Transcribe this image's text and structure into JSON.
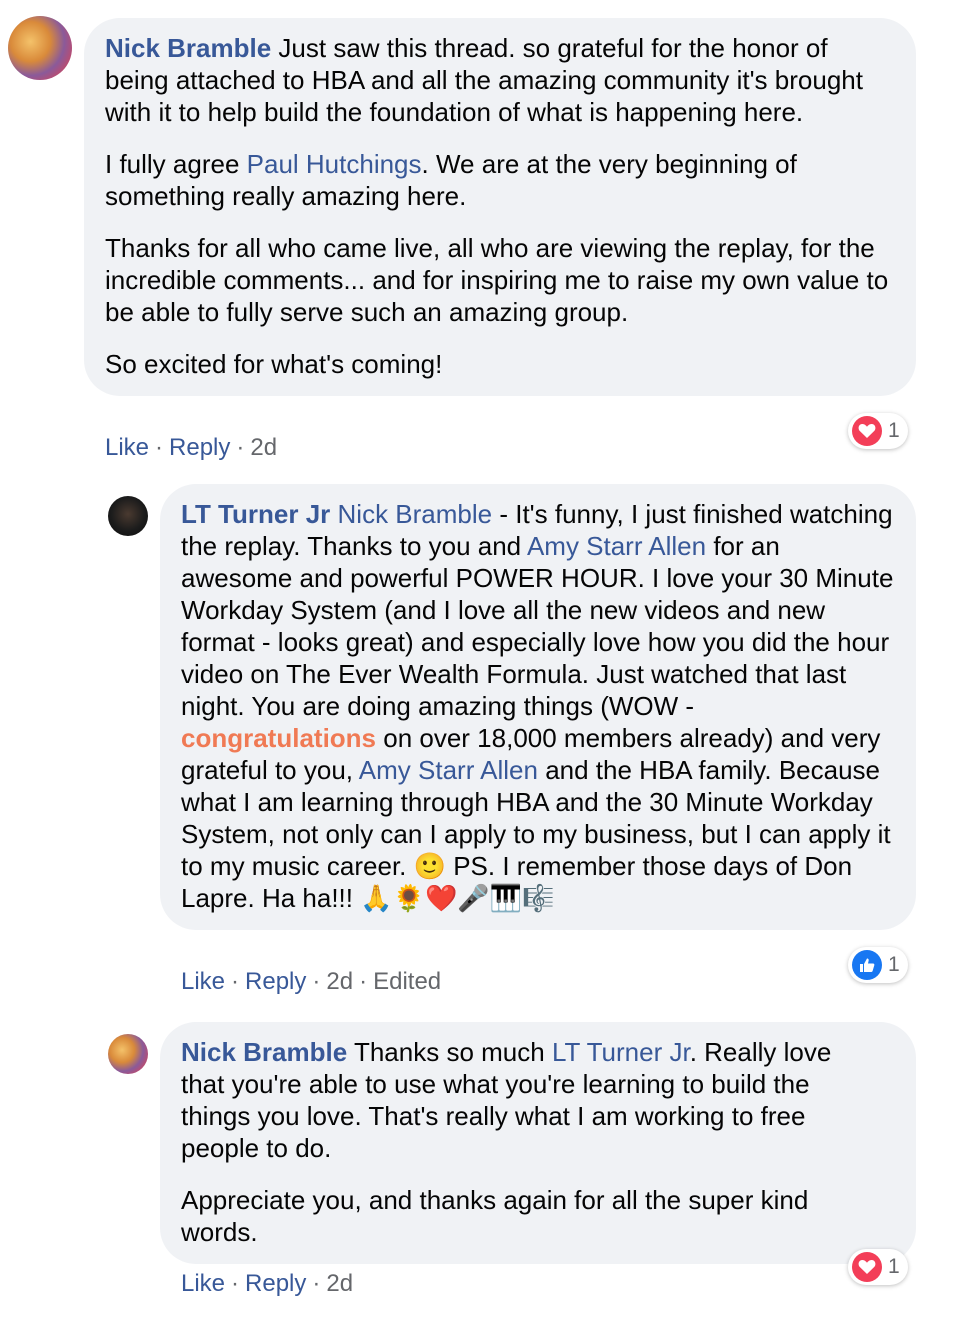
{
  "comments": [
    {
      "author": "Nick Bramble",
      "paragraphs": [
        [
          {
            "t": "text",
            "v": "Just saw this thread. so grateful for the honor of being attached to HBA and all the amazing community it's brought with it to help build the foundation of what is happening here."
          }
        ],
        [
          {
            "t": "text",
            "v": "I fully agree "
          },
          {
            "t": "mention",
            "v": "Paul Hutchings"
          },
          {
            "t": "text",
            "v": ". We are at the very beginning of something really amazing here."
          }
        ],
        [
          {
            "t": "text",
            "v": "Thanks for all who came live, all who are viewing the replay, for the incredible comments... and for inspiring me to raise my own value to be able to fully serve such an amazing group."
          }
        ],
        [
          {
            "t": "text",
            "v": "So excited for what's coming!"
          }
        ]
      ],
      "like": "Like",
      "reply": "Reply",
      "time": "2d",
      "reaction": {
        "type": "love",
        "count": "1"
      }
    },
    {
      "author": "LT Turner Jr",
      "paragraphs": [
        [
          {
            "t": "mention",
            "v": "Nick Bramble"
          },
          {
            "t": "text",
            "v": " - It's funny, I just finished watching the replay. Thanks to you and "
          },
          {
            "t": "mention",
            "v": "Amy Starr Allen"
          },
          {
            "t": "text",
            "v": " for an awesome and powerful POWER HOUR. I love your 30 Minute Workday System (and I love all the new videos and new format - looks great) and especially love how you did the hour video on The Ever Wealth Formula. Just watched that last night. You are doing amazing things (WOW - "
          },
          {
            "t": "highlight",
            "v": "congratulations"
          },
          {
            "t": "text",
            "v": " on over 18,000 members already) and very grateful to you, "
          },
          {
            "t": "mention",
            "v": "Amy Starr Allen"
          },
          {
            "t": "text",
            "v": " and the HBA family. Because what I am learning through HBA and the 30 Minute Workday System, not only can I apply to my business, but I can apply it to my music career. 🙂 PS. I remember those days of Don Lapre. Ha ha!!! 🙏🌻❤️🎤🎹🎼"
          }
        ]
      ],
      "like": "Like",
      "reply": "Reply",
      "time": "2d",
      "edited": "Edited",
      "reaction": {
        "type": "like",
        "count": "1"
      }
    },
    {
      "author": "Nick Bramble",
      "paragraphs": [
        [
          {
            "t": "text",
            "v": "Thanks so much "
          },
          {
            "t": "mention",
            "v": "LT Turner Jr"
          },
          {
            "t": "text",
            "v": ". Really love that you're able to use what you're learning to build the things you love. That's really what I am working to free people to do."
          }
        ],
        [
          {
            "t": "text",
            "v": "Appreciate you, and thanks again for all the super kind words."
          }
        ]
      ],
      "like": "Like",
      "reply": "Reply",
      "time": "2d",
      "reaction": {
        "type": "love",
        "count": "1"
      }
    }
  ],
  "colors": {
    "link": "#385898",
    "highlight": "#f07a54",
    "bubble": "#f0f2f5",
    "meta": "#65676b",
    "love": "#f33e58",
    "like": "#1877f2"
  },
  "icons": {
    "love": "heart-icon",
    "like": "thumbs-up-icon"
  }
}
